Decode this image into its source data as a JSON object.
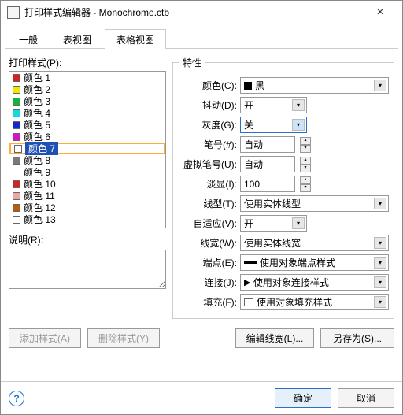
{
  "window": {
    "title": "打印样式编辑器 - Monochrome.ctb"
  },
  "tabs": {
    "general": "一般",
    "table": "表视图",
    "grid": "表格视图",
    "active": 2
  },
  "left": {
    "list_label": "打印样式(P):",
    "items": [
      {
        "label": "颜色 1",
        "color": "#d22222"
      },
      {
        "label": "颜色 2",
        "color": "#f3e40b"
      },
      {
        "label": "颜色 3",
        "color": "#17b23c"
      },
      {
        "label": "颜色 4",
        "color": "#16d9d9"
      },
      {
        "label": "颜色 5",
        "color": "#1429c9"
      },
      {
        "label": "颜色 6",
        "color": "#d215c9"
      },
      {
        "label": "颜色 7",
        "color": "#ffffff",
        "selected": true
      },
      {
        "label": "颜色 8",
        "color": "#7a7a7a"
      },
      {
        "label": "颜色 9",
        "color": "#ffffff"
      },
      {
        "label": "颜色 10",
        "color": "#d22222"
      },
      {
        "label": "颜色 11",
        "color": "#e9a7a7"
      },
      {
        "label": "颜色 12",
        "color": "#b85a0f"
      },
      {
        "label": "颜色 13",
        "color": "#ffffff"
      }
    ],
    "desc_label": "说明(R):",
    "desc_value": ""
  },
  "props": {
    "group_label": "特性",
    "color": {
      "label": "颜色(C):",
      "value": "黑"
    },
    "dither": {
      "label": "抖动(D):",
      "value": "开"
    },
    "gray": {
      "label": "灰度(G):",
      "value": "关"
    },
    "pen": {
      "label": "笔号(#):",
      "value": "自动"
    },
    "vpen": {
      "label": "虚拟笔号(U):",
      "value": "自动"
    },
    "screen": {
      "label": "淡显(I):",
      "value": "100"
    },
    "ltype": {
      "label": "线型(T):",
      "value": "使用实体线型"
    },
    "adapt": {
      "label": "自适应(V):",
      "value": "开"
    },
    "lweight": {
      "label": "线宽(W):",
      "value": "使用实体线宽"
    },
    "endcap": {
      "label": "端点(E):",
      "value": "使用对象端点样式"
    },
    "join": {
      "label": "连接(J):",
      "value": "使用对象连接样式"
    },
    "fill": {
      "label": "填充(F):",
      "value": "使用对象填充样式"
    }
  },
  "buttons": {
    "add": "添加样式(A)",
    "delete": "删除样式(Y)",
    "edit_lw": "编辑线宽(L)...",
    "save_as": "另存为(S)...",
    "ok": "确定",
    "cancel": "取消"
  }
}
